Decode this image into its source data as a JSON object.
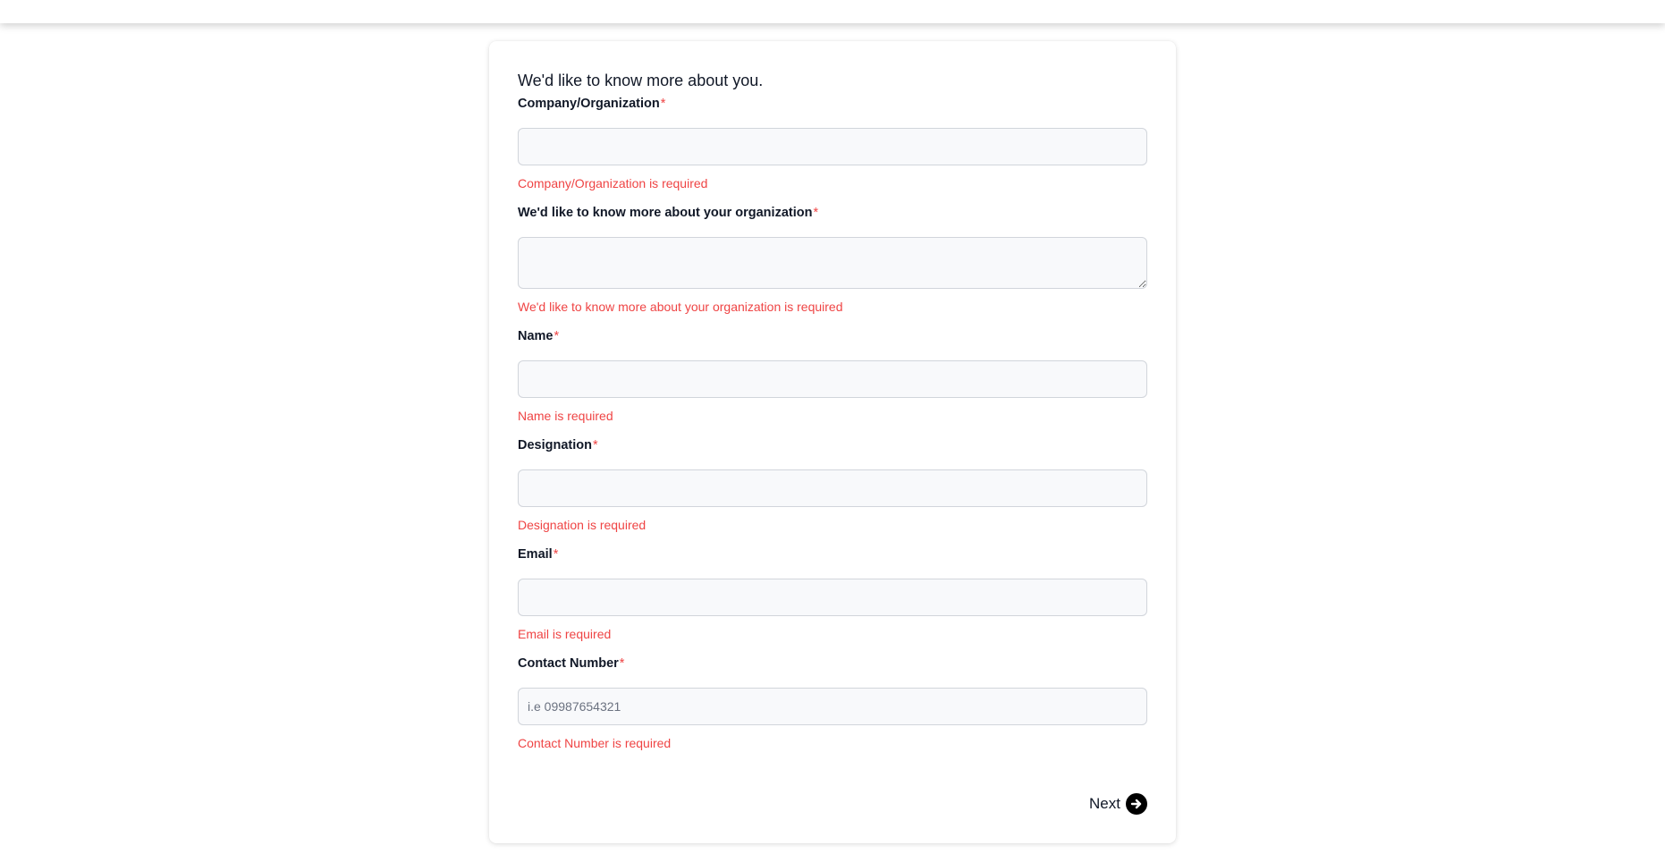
{
  "form": {
    "title": "We'd like to know more about you.",
    "required_marker": "*",
    "fields": [
      {
        "label": "Company/Organization",
        "value": "",
        "placeholder": "",
        "error": "Company/Organization is required"
      },
      {
        "label": "We'd like to know more about your organization",
        "value": "",
        "placeholder": "",
        "error": "We'd like to know more about your organization is required"
      },
      {
        "label": "Name",
        "value": "",
        "placeholder": "",
        "error": "Name is required"
      },
      {
        "label": "Designation",
        "value": "",
        "placeholder": "",
        "error": "Designation is required"
      },
      {
        "label": "Email",
        "value": "",
        "placeholder": "",
        "error": "Email is required"
      },
      {
        "label": "Contact Number",
        "value": "",
        "placeholder": "i.e 09987654321",
        "error": "Contact Number is required"
      }
    ],
    "next_label": "Next",
    "next_icon": "arrow-right-circle-icon"
  },
  "colors": {
    "error": "#ef4444",
    "input_bg": "#f8f9fb",
    "input_border": "#d1d5db",
    "text": "#111827"
  }
}
